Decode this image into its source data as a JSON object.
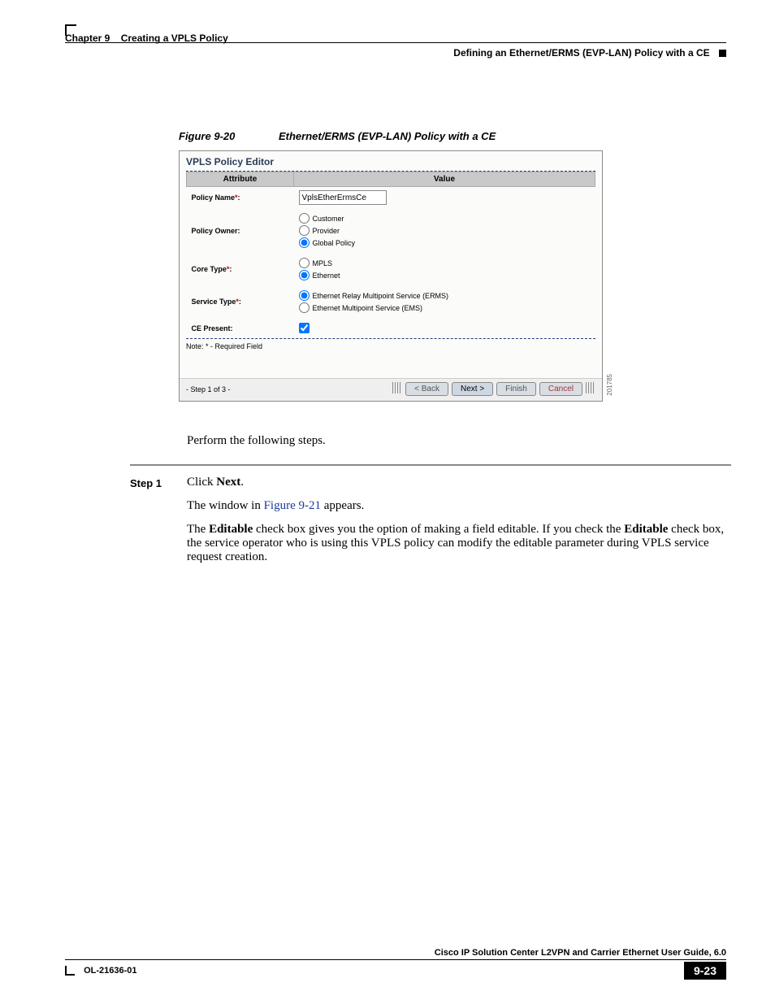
{
  "header": {
    "chapter_label": "Chapter 9",
    "chapter_title": "Creating a VPLS Policy",
    "section_title": "Defining an Ethernet/ERMS (EVP-LAN) Policy with a CE"
  },
  "figure": {
    "number": "Figure 9-20",
    "title": "Ethernet/ERMS (EVP-LAN) Policy with a CE",
    "side_id": "201785"
  },
  "editor": {
    "title": "VPLS Policy Editor",
    "columns": {
      "attribute": "Attribute",
      "value": "Value"
    },
    "rows": {
      "policy_name": {
        "label": "Policy Name",
        "value": "VplsEtherErmsCe"
      },
      "policy_owner": {
        "label": "Policy Owner:",
        "options": [
          "Customer",
          "Provider",
          "Global Policy"
        ],
        "selected": "Global Policy"
      },
      "core_type": {
        "label": "Core Type",
        "options": [
          "MPLS",
          "Ethernet"
        ],
        "selected": "Ethernet"
      },
      "service_type": {
        "label": "Service Type",
        "options": [
          "Ethernet Relay Multipoint Service (ERMS)",
          "Ethernet Multipoint Service (EMS)"
        ],
        "selected": "Ethernet Relay Multipoint Service (ERMS)"
      },
      "ce_present": {
        "label": "CE Present:",
        "checked": true
      }
    },
    "note": "Note: * - Required Field",
    "step_indicator": "- Step 1 of 3 -",
    "buttons": {
      "back": "< Back",
      "next": "Next >",
      "finish": "Finish",
      "cancel": "Cancel"
    }
  },
  "body": {
    "intro": "Perform the following steps.",
    "step1": {
      "label": "Step 1",
      "line1_pre": "Click ",
      "line1_bold": "Next",
      "line1_post": ".",
      "line2_pre": "The window in ",
      "line2_link": "Figure 9-21",
      "line2_post": " appears.",
      "line3_a": "The ",
      "line3_b": "Editable",
      "line3_c": " check box gives you the option of making a field editable. If you check the ",
      "line3_d": "Editable",
      "line3_e": " check box, the service operator who is using this VPLS policy can modify the editable parameter during VPLS service request creation."
    }
  },
  "footer": {
    "guide": "Cisco IP Solution Center L2VPN and Carrier Ethernet User Guide, 6.0",
    "doc_id": "OL-21636-01",
    "page": "9-23"
  }
}
